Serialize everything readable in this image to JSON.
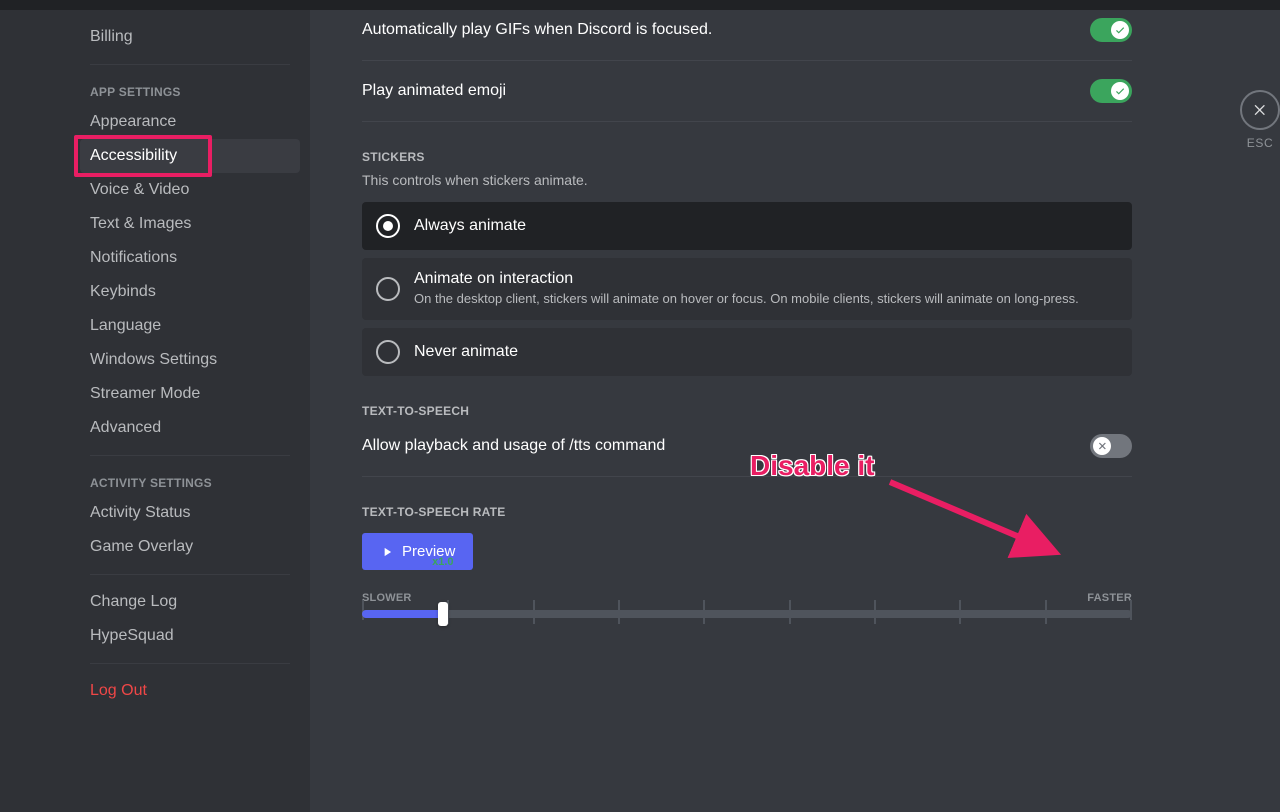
{
  "sidebar": {
    "items_before": [
      "Billing"
    ],
    "headers": {
      "app": "APP SETTINGS",
      "activity": "ACTIVITY SETTINGS"
    },
    "app_items": [
      "Appearance",
      "Accessibility",
      "Voice & Video",
      "Text & Images",
      "Notifications",
      "Keybinds",
      "Language",
      "Windows Settings",
      "Streamer Mode",
      "Advanced"
    ],
    "activity_items": [
      "Activity Status",
      "Game Overlay"
    ],
    "footer_items": [
      "Change Log",
      "HypeSquad"
    ],
    "logout": "Log Out",
    "selected": "Accessibility"
  },
  "close": {
    "label": "ESC"
  },
  "toggles": {
    "gifs": {
      "label": "Automatically play GIFs when Discord is focused.",
      "on": true
    },
    "emoji": {
      "label": "Play animated emoji",
      "on": true
    },
    "tts": {
      "label": "Allow playback and usage of /tts command",
      "on": false
    }
  },
  "stickers": {
    "header": "STICKERS",
    "desc": "This controls when stickers animate.",
    "options": [
      {
        "title": "Always animate",
        "sub": "",
        "selected": true
      },
      {
        "title": "Animate on interaction",
        "sub": "On the desktop client, stickers will animate on hover or focus. On mobile clients, stickers will animate on long-press.",
        "selected": false
      },
      {
        "title": "Never animate",
        "sub": "",
        "selected": false
      }
    ]
  },
  "tts_header": "TEXT-TO-SPEECH",
  "tts_rate": {
    "header": "TEXT-TO-SPEECH RATE",
    "preview": "Preview",
    "left": "SLOWER",
    "right": "FASTER",
    "value": "x1.0"
  },
  "annotation": {
    "text": "Disable it"
  }
}
